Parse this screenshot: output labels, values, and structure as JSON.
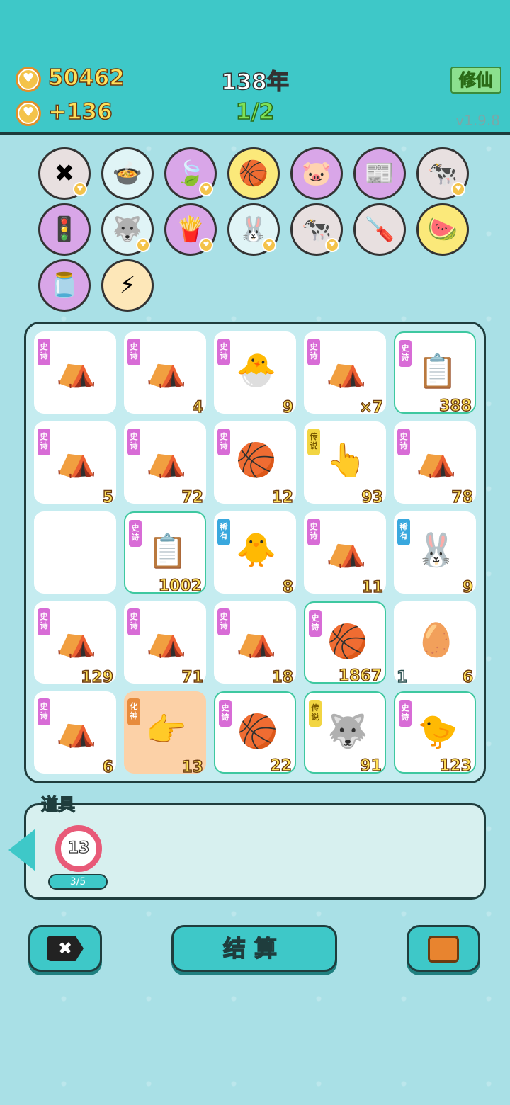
{
  "header": {
    "coins": "50462",
    "income": "+136",
    "year": "138年",
    "step": "1/2",
    "cultivate_button": "修仙",
    "version": "v1.9.8"
  },
  "relics": [
    {
      "icon": "delete-tag-icon",
      "glyph": "✖",
      "bg": "#e8e0e0",
      "tag": true
    },
    {
      "icon": "pressure-cooker-duck-icon",
      "glyph": "🍲",
      "bg": "#e0f4f6",
      "tag": false
    },
    {
      "icon": "leaf-icon",
      "glyph": "🍃",
      "bg": "#d9a6e8",
      "tag": true
    },
    {
      "icon": "basketballs-icon",
      "glyph": "🏀",
      "bg": "#fbe97a",
      "tag": false
    },
    {
      "icon": "piggy-bank-icon",
      "glyph": "🐷",
      "bg": "#d9a6e8",
      "tag": false
    },
    {
      "icon": "time-magazine-icon",
      "glyph": "📰",
      "bg": "#d9a6e8",
      "tag": false
    },
    {
      "icon": "cow-couple-icon",
      "glyph": "🐄",
      "bg": "#e8e0e0",
      "tag": true
    },
    {
      "icon": "traffic-light-ghost-icon",
      "glyph": "🚦",
      "bg": "#d9a6e8",
      "tag": false
    },
    {
      "icon": "husky-dog-icon",
      "glyph": "🐺",
      "bg": "#e0f4f6",
      "tag": true
    },
    {
      "icon": "french-fries-icon",
      "glyph": "🍟",
      "bg": "#d9a6e8",
      "tag": true
    },
    {
      "icon": "rabbit-icon",
      "glyph": "🐰",
      "bg": "#e0f4f6",
      "tag": true
    },
    {
      "icon": "cow-pair-icon",
      "glyph": "🐄",
      "bg": "#e8e0e0",
      "tag": true
    },
    {
      "icon": "screwdriver-icon",
      "glyph": "🪛",
      "bg": "#e8e0e0",
      "tag": false
    },
    {
      "icon": "fruit-basket-icon",
      "glyph": "🍉",
      "bg": "#fbe97a",
      "tag": false
    },
    {
      "icon": "milk-jar-icon",
      "glyph": "🫙",
      "bg": "#d9a6e8",
      "tag": false
    },
    {
      "icon": "lightning-icon",
      "glyph": "⚡",
      "bg": "#fde7b8",
      "tag": false
    }
  ],
  "rarity_labels": {
    "epic": "史诗",
    "rare": "稀有",
    "leg": "传说",
    "god": "化神"
  },
  "board": [
    {
      "icon": "rabbit-tent-icon",
      "glyph": "⛺",
      "rarity": "epic",
      "count": "",
      "hl": false
    },
    {
      "icon": "rabbit-tent-icon",
      "glyph": "⛺",
      "rarity": "epic",
      "count": "4",
      "hl": false
    },
    {
      "icon": "rabbit-tent-chick-icon",
      "glyph": "🐣",
      "rarity": "epic",
      "count": "9",
      "hl": false
    },
    {
      "icon": "rabbit-tent-icon",
      "glyph": "⛺",
      "rarity": "epic",
      "count": "×7",
      "hl": false
    },
    {
      "icon": "copy-paste-icon",
      "glyph": "📋",
      "rarity": "epic",
      "count": "388",
      "hl": true
    },
    {
      "icon": "rabbit-tent-icon",
      "glyph": "⛺",
      "rarity": "epic",
      "count": "5",
      "hl": false
    },
    {
      "icon": "rabbit-tent-icon",
      "glyph": "⛺",
      "rarity": "epic",
      "count": "72",
      "hl": false
    },
    {
      "icon": "basketballs-icon",
      "glyph": "🏀",
      "rarity": "epic",
      "count": "12",
      "hl": false
    },
    {
      "icon": "pointing-hand-icon",
      "glyph": "👆",
      "rarity": "leg",
      "count": "93",
      "hl": false
    },
    {
      "icon": "rabbit-tent-icon",
      "glyph": "⛺",
      "rarity": "epic",
      "count": "78",
      "hl": false
    },
    {
      "icon": "empty-slot",
      "glyph": "",
      "rarity": "",
      "count": "",
      "hl": false
    },
    {
      "icon": "copy-paste-icon",
      "glyph": "📋",
      "rarity": "epic",
      "count": "1002",
      "hl": true
    },
    {
      "icon": "chicken-basketball-icon",
      "glyph": "🐥",
      "rarity": "rare",
      "count": "8",
      "hl": false
    },
    {
      "icon": "rabbit-tent-icon",
      "glyph": "⛺",
      "rarity": "epic",
      "count": "11",
      "hl": false
    },
    {
      "icon": "rabbit-icon",
      "glyph": "🐰",
      "rarity": "rare",
      "count": "9",
      "hl": false
    },
    {
      "icon": "rabbit-tent-icon",
      "glyph": "⛺",
      "rarity": "epic",
      "count": "129",
      "hl": false
    },
    {
      "icon": "rabbit-tent-icon",
      "glyph": "⛺",
      "rarity": "epic",
      "count": "71",
      "hl": false
    },
    {
      "icon": "rabbit-tent-basketball-icon",
      "glyph": "⛺",
      "rarity": "epic",
      "count": "18",
      "hl": false
    },
    {
      "icon": "copy-paste-basketball-icon",
      "glyph": "🏀",
      "rarity": "epic",
      "count": "1867",
      "hl": true
    },
    {
      "icon": "egg-icon",
      "glyph": "🥚",
      "rarity": "",
      "count": "6",
      "countl": "1",
      "hl": false
    },
    {
      "icon": "rabbit-tent-icon",
      "glyph": "⛺",
      "rarity": "epic",
      "count": "6",
      "hl": false
    },
    {
      "icon": "golden-hand-basketball-icon",
      "glyph": "👉",
      "rarity": "god",
      "count": "13",
      "hl": false,
      "orange": true
    },
    {
      "icon": "chick-basketball-icon",
      "glyph": "🏀",
      "rarity": "epic",
      "count": "22",
      "hl": true
    },
    {
      "icon": "husky-king-icon",
      "glyph": "🐺",
      "rarity": "leg",
      "count": "91",
      "hl": true
    },
    {
      "icon": "chick-icon",
      "glyph": "🐤",
      "rarity": "epic",
      "count": "123",
      "hl": true
    }
  ],
  "items": {
    "label": "道具",
    "badge_value": "13",
    "progress": "3/5"
  },
  "footer": {
    "delete_label": "✖",
    "settle_label": "结算",
    "bag_icon": "briefcase-icon"
  }
}
